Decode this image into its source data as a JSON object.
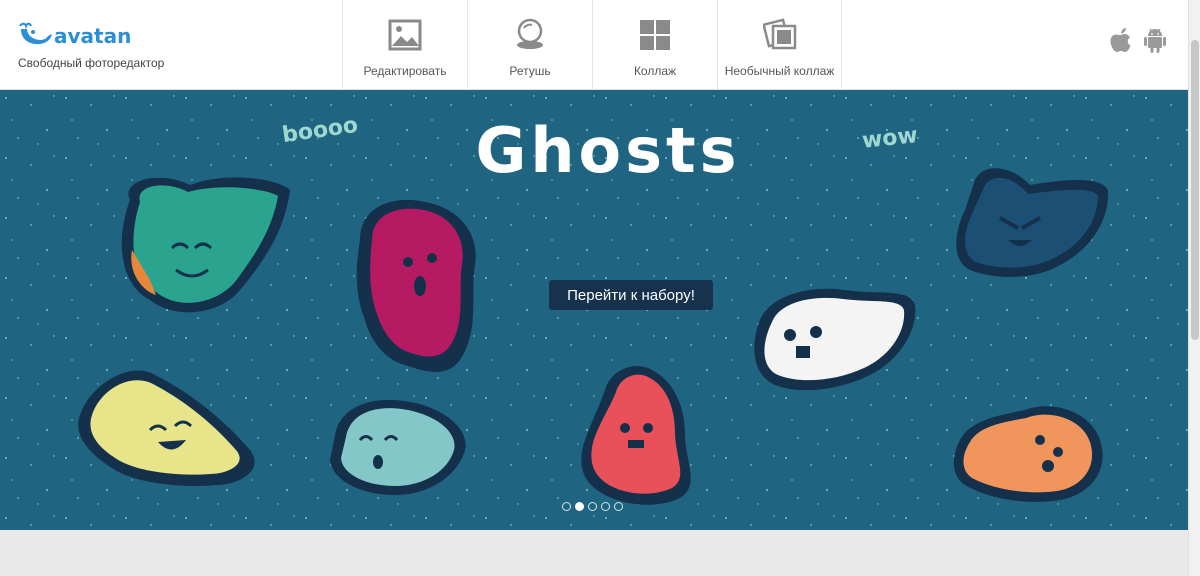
{
  "brand": {
    "name": "avatan",
    "tagline": "Свободный фоторедактор"
  },
  "nav": {
    "items": [
      {
        "label": "Редактировать",
        "icon": "image-icon"
      },
      {
        "label": "Ретушь",
        "icon": "compact-mirror-icon"
      },
      {
        "label": "Коллаж",
        "icon": "grid-icon"
      },
      {
        "label": "Необычный коллаж",
        "icon": "stacked-photos-icon"
      }
    ]
  },
  "platforms": [
    "apple-icon",
    "android-icon"
  ],
  "banner": {
    "title": "Ghosts",
    "word_left": "boooo",
    "word_right": "wow",
    "cta_label": "Перейти к набору!",
    "background_color": "#1f6582",
    "slides_total": 5,
    "active_slide": 2
  }
}
